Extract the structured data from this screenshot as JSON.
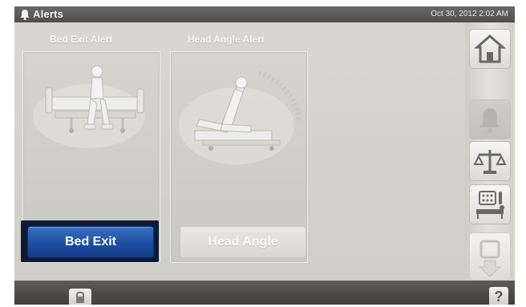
{
  "header": {
    "title": "Alerts",
    "datetime": "Oct 30, 2012 2:02 AM"
  },
  "cards": [
    {
      "title": "Bed Exit Alert",
      "button_label": "Bed Exit",
      "selected": true
    },
    {
      "title": "Head Angle Alert",
      "button_label": "Head Angle",
      "selected": false
    }
  ],
  "help": {
    "label": "?"
  },
  "icons": {
    "header": "bell-icon",
    "nav": [
      "home-icon",
      "alert-bell-icon",
      "scale-icon",
      "therapy-icon",
      "more-arrow-icon"
    ],
    "bottom": [
      "lock-icon"
    ]
  },
  "colors": {
    "selected_button": "#1c4fa2",
    "selected_frame": "#0d1a36",
    "background": "#d9d7d1"
  }
}
